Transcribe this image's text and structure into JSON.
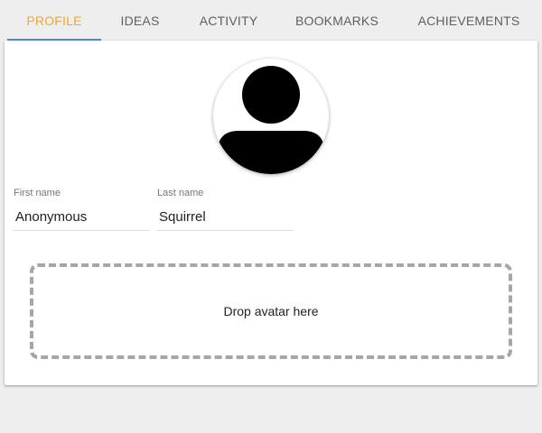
{
  "tabs": {
    "profile": "PROFILE",
    "ideas": "IDEAS",
    "activity": "ACTIVITY",
    "bookmarks": "BOOKMARKS",
    "achievements": "ACHIEVEMENTS",
    "active": "profile"
  },
  "colors": {
    "active_tab": "#f5a623",
    "tab_indicator": "#4a8fe0",
    "page_background": "#eeeeee",
    "card_background": "#ffffff"
  },
  "profile": {
    "avatar_icon": "default-user-silhouette-icon",
    "first_name": {
      "label": "First name",
      "value": "Anonymous"
    },
    "last_name": {
      "label": "Last name",
      "value": "Squirrel"
    },
    "dropzone_label": "Drop avatar here"
  }
}
